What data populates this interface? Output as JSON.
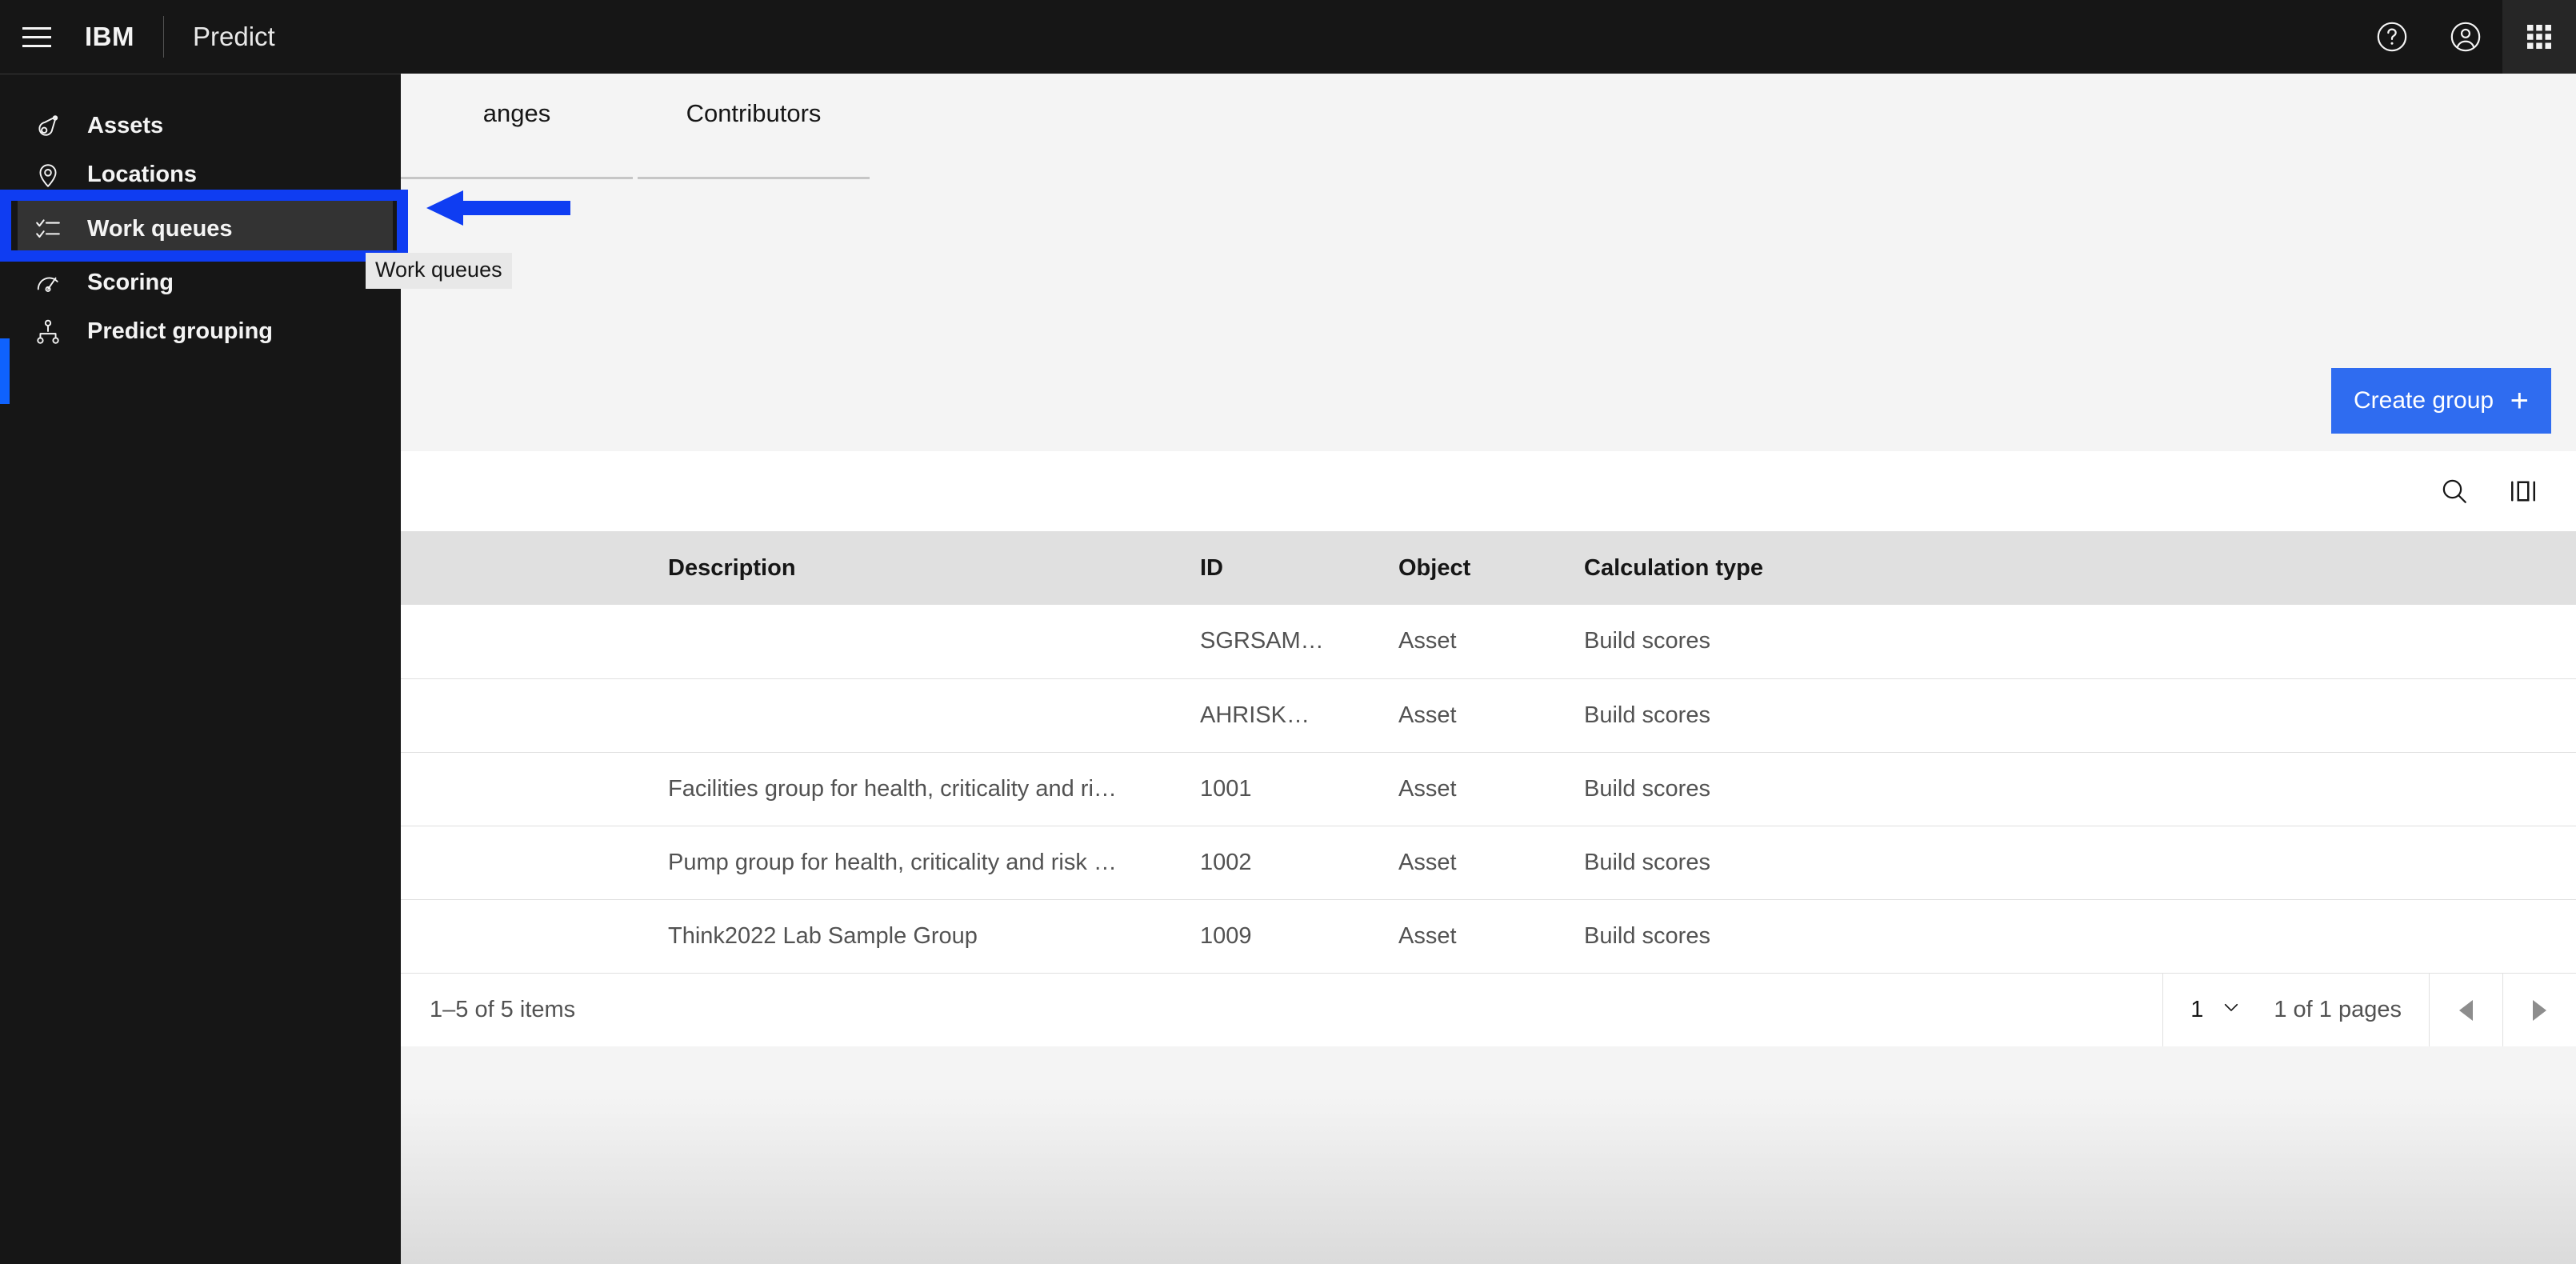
{
  "header": {
    "menu_icon": "hamburger-menu-icon",
    "brand": "IBM",
    "product": "Predict",
    "help_icon": "help-circle-icon",
    "account_icon": "user-avatar-icon",
    "app_switcher_icon": "app-grid-icon"
  },
  "sidebar": {
    "items": [
      {
        "label": "Assets",
        "icon": "asset-tag-icon",
        "selected": false
      },
      {
        "label": "Locations",
        "icon": "location-pin-icon",
        "selected": false
      },
      {
        "label": "Work queues",
        "icon": "checklist-icon",
        "selected": true
      },
      {
        "label": "Scoring",
        "icon": "gauge-icon",
        "selected": false
      },
      {
        "label": "Predict grouping",
        "icon": "hierarchy-icon",
        "selected": false
      }
    ]
  },
  "main": {
    "tabs": [
      {
        "label": "anges",
        "active": false
      },
      {
        "label": "Contributors",
        "active": false
      }
    ],
    "create_group": {
      "label": "Create group",
      "plus": "+"
    },
    "toolbar": {
      "search_icon": "search-icon",
      "columns_icon": "column-settings-icon"
    },
    "table": {
      "columns": [
        "",
        "Description",
        "ID",
        "Object",
        "Calculation type"
      ],
      "rows": [
        {
          "select": "",
          "description": "",
          "id": "SGRSAM…",
          "object": "Asset",
          "calculation_type": "Build scores"
        },
        {
          "select": "",
          "description": "",
          "id": "AHRISK…",
          "object": "Asset",
          "calculation_type": "Build scores"
        },
        {
          "select": "",
          "description": "Facilities group for health, criticality and ri…",
          "id": "1001",
          "object": "Asset",
          "calculation_type": "Build scores"
        },
        {
          "select": "",
          "description": "Pump group for health, criticality and risk …",
          "id": "1002",
          "object": "Asset",
          "calculation_type": "Build scores"
        },
        {
          "select": "",
          "description": "Think2022 Lab Sample Group",
          "id": "1009",
          "object": "Asset",
          "calculation_type": "Build scores"
        }
      ]
    },
    "pagination": {
      "items_range": "1–5 of 5 items",
      "page_value": "1",
      "pages_label": "1 of 1 pages",
      "prev_icon": "caret-left-icon",
      "next_icon": "caret-right-icon"
    }
  },
  "annotations": {
    "highlight_box": "work-queues-highlight",
    "arrow": "pointer-arrow-left",
    "tooltip_text": "Work queues",
    "accent_color": "#0f3df2",
    "button_color": "#2f6cf0",
    "nav_accent_color": "#0f62fe"
  }
}
